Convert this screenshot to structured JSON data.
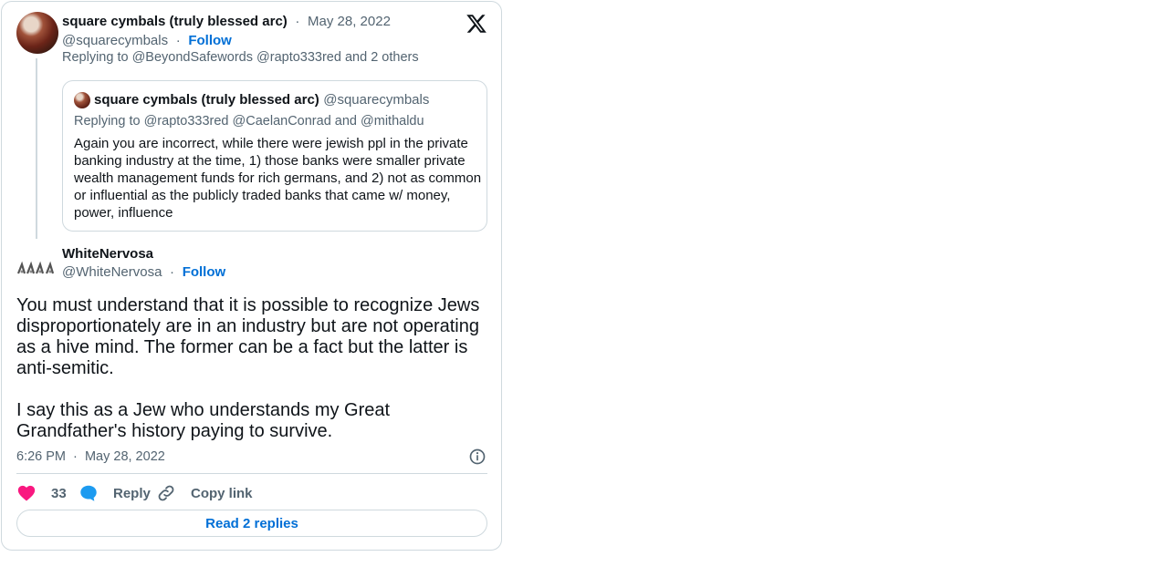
{
  "parent_tweet": {
    "author_name": "square cymbals (truly blessed arc)",
    "date": "May 28, 2022",
    "handle": "@squarecymbals",
    "follow_label": "Follow",
    "replying_prefix": "Replying to",
    "replying_to": [
      "@BeyondSafewords",
      "@rapto333red"
    ],
    "replying_others": "and 2 others"
  },
  "quoted_tweet": {
    "author_name": "square cymbals (truly blessed arc)",
    "handle": "@squarecymbals",
    "replying_prefix": "Replying to",
    "replying_to": [
      "@rapto333red",
      "@CaelanConrad"
    ],
    "replying_and": "and",
    "replying_last": "@mithaldu",
    "text": "Again you are incorrect, while there were jewish ppl in the private banking industry at the time, 1) those banks were smaller private wealth management funds for rich germans, and 2) not as common or influential as the publicly traded banks that came w/ money, power, influence"
  },
  "main_tweet": {
    "author_name": "WhiteNervosa",
    "handle": "@WhiteNervosa",
    "follow_label": "Follow",
    "paragraph1": "You must understand that it is possible to recognize Jews disproportionately are in an industry but are not operating as a hive mind. The former can be a fact but the latter is anti-semitic.",
    "paragraph2": "I say this as a Jew who understands my Great Grandfather's history paying to survive.",
    "time": "6:26 PM",
    "date": "May 28, 2022"
  },
  "actions": {
    "like_count": "33",
    "reply_label": "Reply",
    "copy_label": "Copy link",
    "read_replies_label": "Read 2 replies"
  },
  "colors": {
    "link_blue": "#006fd6",
    "like_pink": "#f91880",
    "reply_blue": "#1d9bf0",
    "muted": "#536471",
    "border": "#cfd9de"
  },
  "icons": [
    "x-logo-icon",
    "info-icon",
    "heart-icon",
    "reply-bubble-icon",
    "link-icon"
  ]
}
